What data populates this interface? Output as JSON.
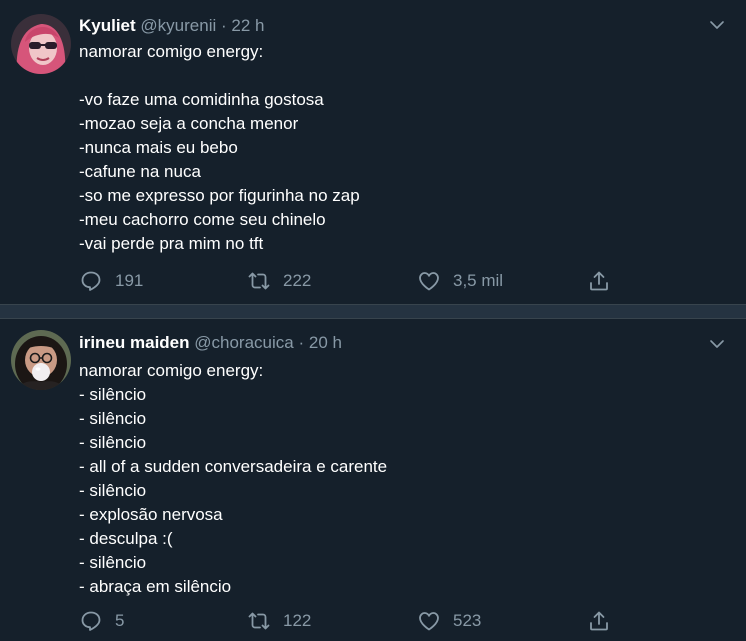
{
  "tweets": [
    {
      "display_name": "Kyuliet",
      "handle": "@kyurenii",
      "separator": "·",
      "time": "22 h",
      "lines": [
        "namorar comigo energy:",
        "",
        "-vo faze uma comidinha gostosa",
        "-mozao seja a concha menor",
        "-nunca mais eu bebo",
        "-cafune na nuca",
        "-so me expresso por figurinha no zap",
        "-meu cachorro come seu chinelo",
        "-vai perde pra mim no tft"
      ],
      "replies": "191",
      "retweets": "222",
      "likes": "3,5 mil"
    },
    {
      "display_name": "irineu maiden",
      "handle": "@choracuica",
      "separator": "·",
      "time": "20 h",
      "lines": [
        "namorar comigo energy:",
        "- silêncio",
        "- silêncio",
        "- silêncio",
        "- all of a sudden conversadeira e carente",
        "- silêncio",
        "- explosão nervosa",
        "- desculpa :(",
        "- silêncio",
        "- abraça em silêncio"
      ],
      "replies": "5",
      "retweets": "122",
      "likes": "523"
    }
  ],
  "icons": {
    "reply": "reply-icon",
    "retweet": "retweet-icon",
    "like": "heart-icon",
    "share": "share-icon",
    "menu": "chevron-down-icon"
  },
  "colors": {
    "background": "#15202b",
    "separator": "#253341",
    "secondary_text": "#8899a6",
    "primary_text": "#ffffff"
  }
}
